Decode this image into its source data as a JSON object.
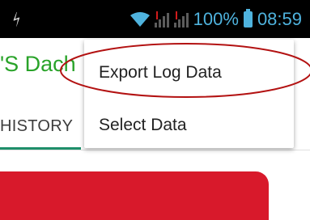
{
  "status_bar": {
    "battery_percent": "100%",
    "time": "08:59",
    "accent_color": "#4fb3de",
    "icons": [
      "usb-icon",
      "wifi-icon",
      "signal-icon",
      "signal-icon",
      "battery-icon"
    ]
  },
  "app": {
    "title_fragment": "'S Dach",
    "title_color": "#29a329"
  },
  "tabs": {
    "history_label": "HISTORY"
  },
  "menu": {
    "items": [
      {
        "label": "Export Log Data"
      },
      {
        "label": "Select Data"
      }
    ]
  },
  "card": {
    "color": "#d8192b"
  },
  "annotation": {
    "color": "#b31212"
  }
}
